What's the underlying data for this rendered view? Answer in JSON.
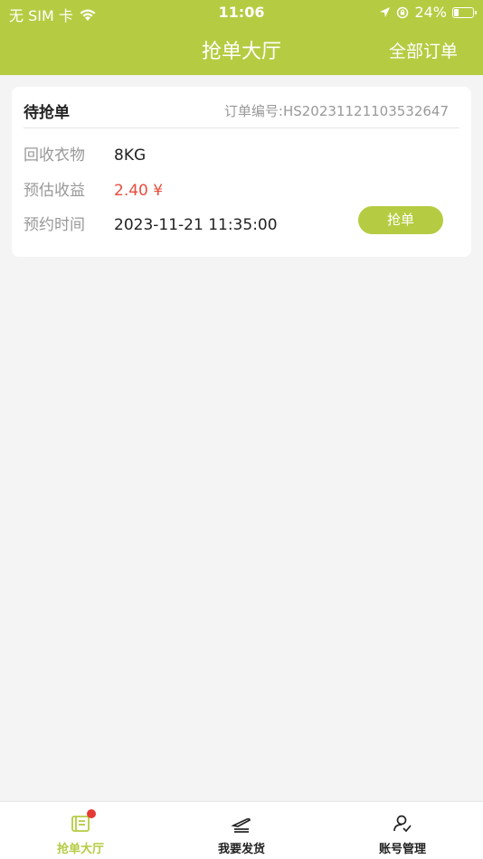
{
  "status_bar": {
    "carrier": "无 SIM 卡",
    "time": "11:06",
    "battery": "24%"
  },
  "header": {
    "title": "抢单大厅",
    "right_action": "全部订单"
  },
  "order": {
    "status": "待抢单",
    "order_no": "订单编号:HS20231121103532647",
    "fields": [
      {
        "label": "回收衣物",
        "value": "8KG"
      },
      {
        "label": "预估收益",
        "value": "2.40 ¥"
      },
      {
        "label": "预约时间",
        "value": "2023-11-21 11:35:00"
      }
    ],
    "action_label": "抢单"
  },
  "tabbar": {
    "items": [
      {
        "label": "抢单大厅",
        "icon": "order-hall-icon"
      },
      {
        "label": "我要发货",
        "icon": "ship-icon"
      },
      {
        "label": "账号管理",
        "icon": "account-icon"
      }
    ]
  },
  "colors": {
    "accent": "#b5cc42",
    "price": "#e84c3d",
    "badge": "#e53935"
  }
}
